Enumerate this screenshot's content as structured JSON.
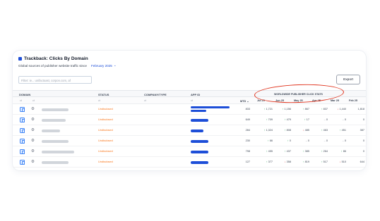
{
  "title": "Trackback: Clicks By Domain",
  "subtitle": "Global sources of publisher website traffic since",
  "period": "February 2025",
  "filter_placeholder": "Filter: ie... unifactoast, corpon.com, af",
  "export_label": "Export",
  "columns": {
    "domain": "DOMAIN",
    "status": "STATUS",
    "company": "COMPANY/TYPE",
    "app_id": "APP ID",
    "stats_group": "WORLDWIDE PUBLISHER CLICK STATS",
    "sub_domain": "ct",
    "sub_status": "ct",
    "sub_company": "ct",
    "sub_app": "ct",
    "mtd": "MTD",
    "months": [
      "Jul 25",
      "Jun 25",
      "May 25",
      "Apr 25",
      "Mar 25",
      "Feb 25"
    ]
  },
  "rows": [
    {
      "status": "Undisclosed",
      "mtd": "833",
      "cells": [
        {
          "t": "1,721",
          "d": "up"
        },
        {
          "t": "1,156",
          "d": "up"
        },
        {
          "t": "867",
          "d": "up"
        },
        {
          "t": "837",
          "d": "up"
        },
        {
          "t": "1,440",
          "d": "down"
        },
        {
          "t": "1,818",
          "d": "none"
        }
      ],
      "domain_w": 38,
      "bars": [
        55,
        22
      ]
    },
    {
      "status": "Undisclosed",
      "mtd": "649",
      "cells": [
        {
          "t": "709",
          "d": "up"
        },
        {
          "t": "479",
          "d": "up"
        },
        {
          "t": "17",
          "d": "up"
        },
        {
          "t": "0",
          "d": "neutral"
        },
        {
          "t": "0",
          "d": "neutral"
        },
        {
          "t": "0",
          "d": "none"
        }
      ],
      "domain_w": 34,
      "bars": [
        25
      ]
    },
    {
      "status": "Undisclosed",
      "mtd": "284",
      "cells": [
        {
          "t": "1,324",
          "d": "up"
        },
        {
          "t": "808",
          "d": "up"
        },
        {
          "t": "485",
          "d": "down"
        },
        {
          "t": "463",
          "d": "up"
        },
        {
          "t": "451",
          "d": "up"
        },
        {
          "t": "387",
          "d": "none"
        }
      ],
      "domain_w": 26,
      "bars": [
        18
      ]
    },
    {
      "status": "Undisclosed",
      "mtd": "230",
      "cells": [
        {
          "t": "66",
          "d": "up"
        },
        {
          "t": "0",
          "d": "up"
        },
        {
          "t": "0",
          "d": "neutral"
        },
        {
          "t": "0",
          "d": "neutral"
        },
        {
          "t": "0",
          "d": "neutral"
        },
        {
          "t": "0",
          "d": "none"
        }
      ],
      "domain_w": 38,
      "bars": [
        25
      ]
    },
    {
      "status": "Undisclosed",
      "mtd": "798",
      "cells": [
        {
          "t": "455",
          "d": "up"
        },
        {
          "t": "437",
          "d": "up"
        },
        {
          "t": "385",
          "d": "up"
        },
        {
          "t": "264",
          "d": "up"
        },
        {
          "t": "86",
          "d": "up"
        },
        {
          "t": "0",
          "d": "none"
        }
      ],
      "domain_w": 46,
      "bars": [
        25
      ]
    },
    {
      "status": "Undisclosed",
      "mtd": "127",
      "cells": [
        {
          "t": "377",
          "d": "up"
        },
        {
          "t": "358",
          "d": "down"
        },
        {
          "t": "819",
          "d": "up"
        },
        {
          "t": "517",
          "d": "up"
        },
        {
          "t": "510",
          "d": "down"
        },
        {
          "t": "644",
          "d": "none"
        }
      ],
      "domain_w": 38,
      "bars": [
        25
      ]
    }
  ],
  "colors": {
    "accent": "#1d4ed8",
    "status": "#f97316",
    "annotation": "#e0341e"
  }
}
